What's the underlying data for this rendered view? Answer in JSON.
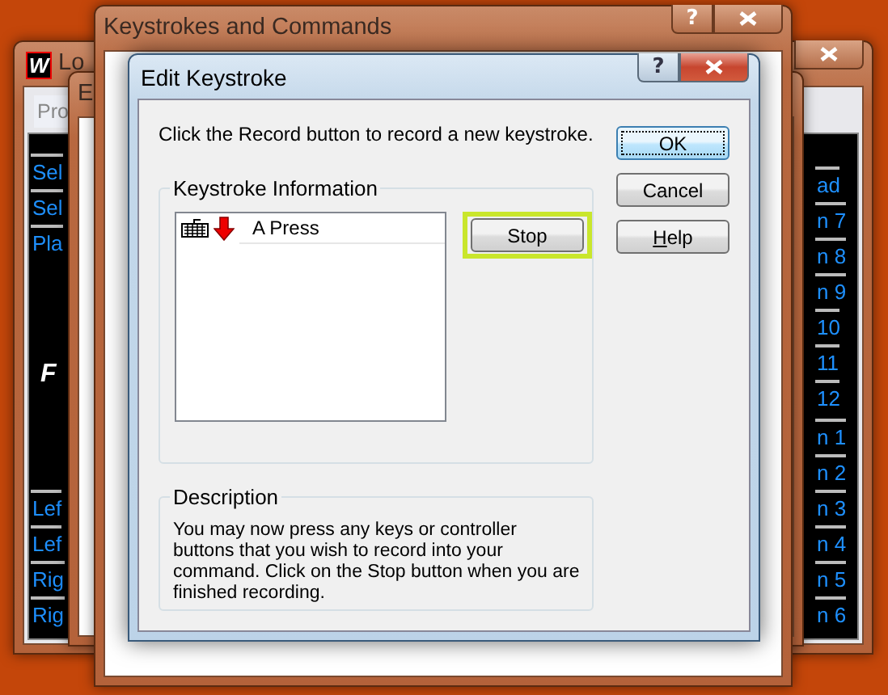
{
  "background_windows": [
    {
      "kind": "plain",
      "title": "Keystrokes and Commands",
      "help_glyph": "?",
      "close_button": true
    },
    {
      "kind": "plain",
      "title": "E"
    },
    {
      "kind": "panel",
      "logo": "W",
      "title": "Lo",
      "close_button": true,
      "tab": "Pro",
      "left_items": [
        "Sel",
        "Sel",
        "Pla"
      ],
      "center_mark": "F",
      "left_bottom_items": [
        "Lef",
        "Lef",
        "Rig",
        "Rig"
      ],
      "right_items": [
        "ad",
        "n 7",
        "n 8",
        "n 9",
        "10",
        "11",
        "12"
      ],
      "right_bottom_items": [
        "n 1",
        "n 2",
        "n 3",
        "n 4",
        "n 5",
        "n 6"
      ]
    }
  ],
  "dialog": {
    "title": "Edit Keystroke",
    "help_glyph": "?",
    "instruction": "Click the Record button to record a new keystroke.",
    "keystroke_group": {
      "label": "Keystroke Information",
      "events": [
        {
          "kind": "key_press",
          "text": "A Press"
        }
      ]
    },
    "record_button": {
      "label": "Stop",
      "highlighted": true
    },
    "description_group": {
      "label": "Description",
      "text": "You may now press any keys or controller buttons that you wish to record into your command.  Click on the Stop button when you are finished recording."
    },
    "buttons": [
      {
        "label": "OK",
        "focused": true,
        "underline_first": false
      },
      {
        "label": "Cancel",
        "focused": false,
        "underline_first": false
      },
      {
        "label": "Help",
        "focused": false,
        "underline_first": true
      }
    ]
  }
}
